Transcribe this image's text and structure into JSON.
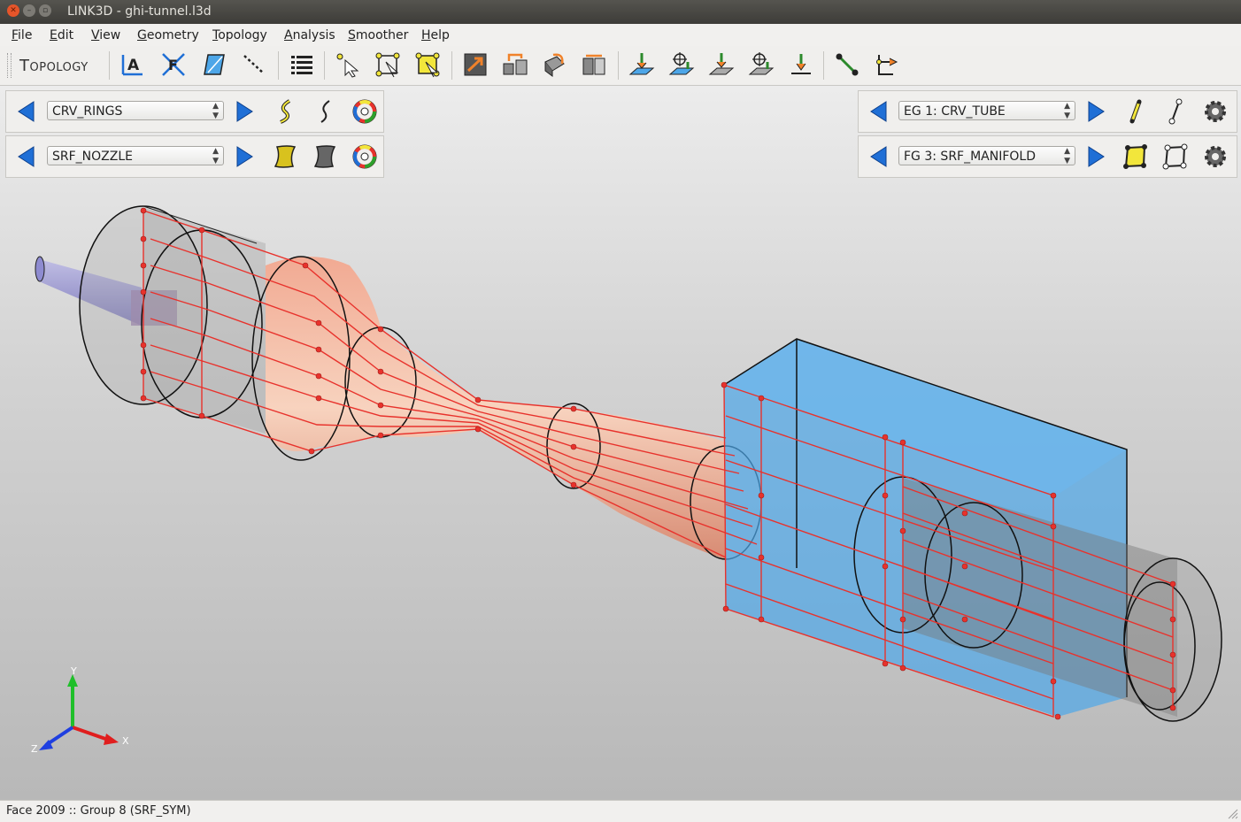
{
  "window": {
    "title": "LINK3D - ghi-tunnel.l3d"
  },
  "menu": {
    "items": [
      "File",
      "Edit",
      "View",
      "Geometry",
      "Topology",
      "Analysis",
      "Smoother",
      "Help"
    ]
  },
  "toolbar": {
    "label": "Topology"
  },
  "panels": {
    "curve_select": {
      "value": "CRV_RINGS"
    },
    "surface_select": {
      "value": "SRF_NOZZLE"
    },
    "edge_group_select": {
      "value": "EG 1: CRV_TUBE"
    },
    "face_group_select": {
      "value": "FG 3: SRF_MANIFOLD"
    }
  },
  "axes": {
    "x": "X",
    "y": "Y",
    "z": "Z"
  },
  "status": {
    "text": "Face 2009 :: Group 8 (SRF_SYM)"
  },
  "colors": {
    "accent": "#1f6fd6",
    "mesh_red": "#e8322c",
    "manifold_blue": "#4da6e8"
  }
}
